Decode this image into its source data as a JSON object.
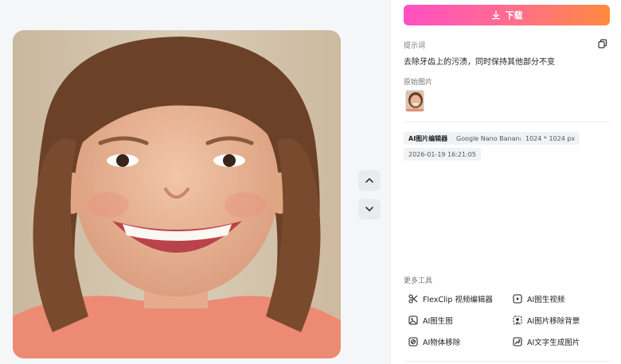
{
  "header": {
    "download_label": "下载"
  },
  "prompt": {
    "title": "提示词",
    "text": "去除牙齿上的污渍，同时保持其他部分不变"
  },
  "original_image": {
    "title": "原始图片"
  },
  "meta_tags": [
    "AI图片编辑器",
    "Google Nano Banana",
    "1024 * 1024 px",
    "2026-01-19 16:21:05"
  ],
  "more_tools": {
    "title": "更多工具",
    "items": [
      {
        "label": "FlexClip 视频编辑器",
        "icon": "scissors-icon"
      },
      {
        "label": "AI图生视频",
        "icon": "image-video-icon"
      },
      {
        "label": "AI图生图",
        "icon": "image-to-image-icon"
      },
      {
        "label": "AI图片移除背景",
        "icon": "remove-background-icon"
      },
      {
        "label": "AI物体移除",
        "icon": "object-remove-icon"
      },
      {
        "label": "AI文字生成图片",
        "icon": "text-to-image-icon"
      }
    ]
  },
  "colors": {
    "accent_start": "#ff4fc4",
    "accent_end": "#ff8a3d"
  }
}
